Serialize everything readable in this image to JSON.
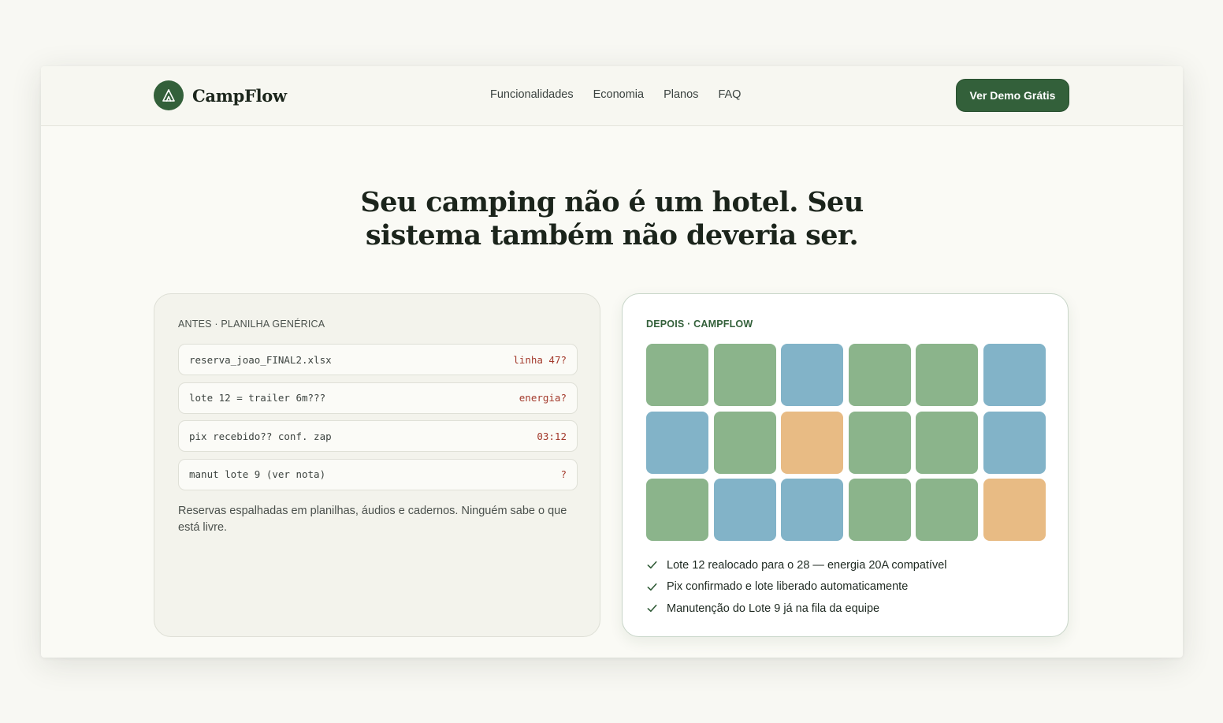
{
  "brand": {
    "name": "CampFlow",
    "logo_icon": "tent-icon",
    "color": "#33603a"
  },
  "nav": {
    "links": [
      "Funcionalidades",
      "Economia",
      "Planos",
      "FAQ"
    ],
    "cta_label": "Ver Demo Grátis"
  },
  "headline": {
    "line1": "Seu camping não é um hotel. Seu",
    "line2": "sistema também não deveria ser."
  },
  "before": {
    "label": "ANTES · PLANILHA GENÉRICA",
    "rows": [
      {
        "text": "reserva_joao_FINAL2.xlsx",
        "flag": "linha 47?"
      },
      {
        "text": "lote 12 = trailer 6m???",
        "flag": "energia?"
      },
      {
        "text": "pix recebido?? conf. zap",
        "flag": "03:12"
      },
      {
        "text": "manut lote 9 (ver nota)",
        "flag": "?"
      }
    ],
    "note": "Reservas espalhadas em planilhas, áudios e cadernos. Ninguém sabe o que está livre."
  },
  "after": {
    "label": "DEPOIS · CAMPFLOW",
    "lot_colors": {
      "green": "#8bb48b",
      "blue": "#82b3c8",
      "orange": "#e8bb84"
    },
    "lots": [
      [
        "green",
        "green",
        "blue",
        "green",
        "green",
        "blue"
      ],
      [
        "blue",
        "green",
        "orange",
        "green",
        "green",
        "blue"
      ],
      [
        "green",
        "blue",
        "blue",
        "green",
        "green",
        "orange"
      ]
    ],
    "checks": [
      "Lote 12 realocado para o 28 — energia 20A compatível",
      "Pix confirmado e lote liberado automaticamente",
      "Manutenção do Lote 9 já na fila da equipe"
    ],
    "check_icon": "checkmark-icon"
  }
}
